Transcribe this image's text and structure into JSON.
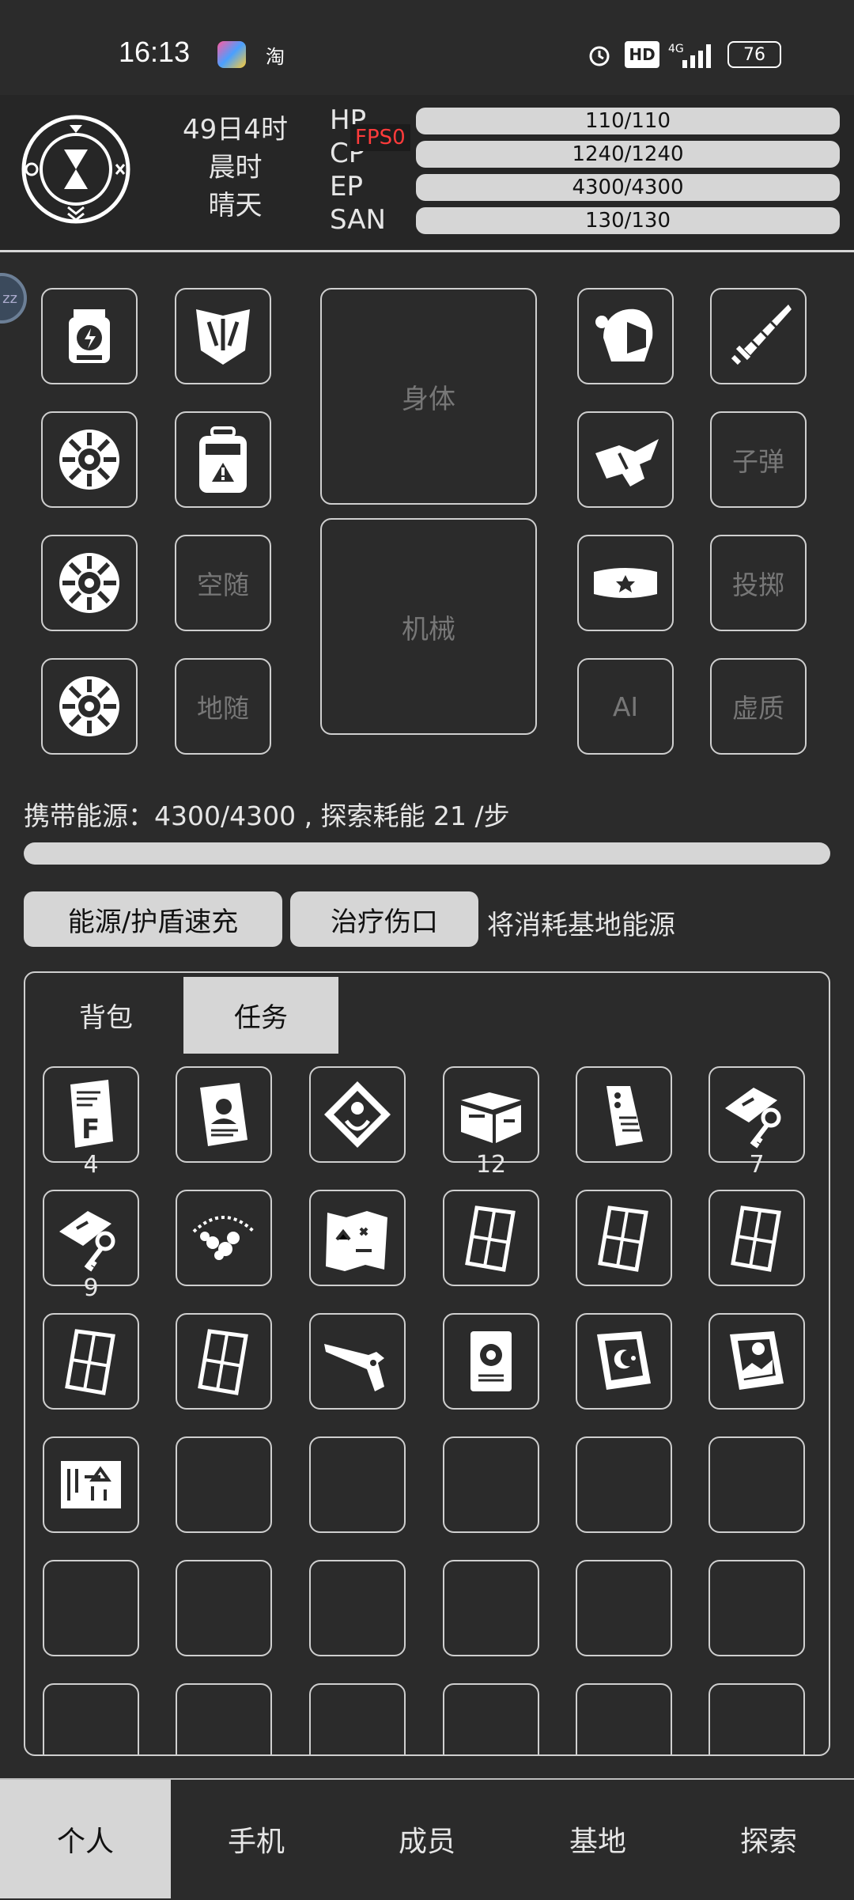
{
  "status_bar": {
    "time": "16:13",
    "app_icon_label": "淘",
    "hd_label": "HD",
    "network": "4G",
    "battery": "76"
  },
  "header": {
    "date": "49日4时",
    "period": "晨时",
    "weather": "晴天",
    "fps_label": "FPS0",
    "stats": [
      {
        "label": "HP",
        "value": "110/110"
      },
      {
        "label": "CP",
        "value": "1240/1240"
      },
      {
        "label": "EP",
        "value": "4300/4300"
      },
      {
        "label": "SAN",
        "value": "130/130"
      }
    ]
  },
  "sleep_badge": "zz",
  "equipment": {
    "body_label": "身体",
    "mech_label": "机械",
    "empty_labels": {
      "air": "空随",
      "ground": "地随",
      "bullet": "子弹",
      "throw": "投掷",
      "ai": "AI",
      "void": "虚质"
    }
  },
  "energy": {
    "text": "携带能源：4300/4300 , 探索耗能 21 /步",
    "fill_fraction": 1.0
  },
  "actions": {
    "recharge_label": "能源/护盾速充",
    "heal_label": "治疗伤口",
    "note": "将消耗基地能源"
  },
  "inventory": {
    "tabs": [
      "背包",
      "任务"
    ],
    "counts": {
      "file": "4",
      "crate": "12",
      "key1": "7",
      "key2": "9"
    }
  },
  "bottom_nav": [
    "个人",
    "手机",
    "成员",
    "基地",
    "探索"
  ],
  "colors": {
    "background": "#2b2b2b",
    "accent_light": "#d6d6d6",
    "fps_red": "#ff3b3b"
  }
}
